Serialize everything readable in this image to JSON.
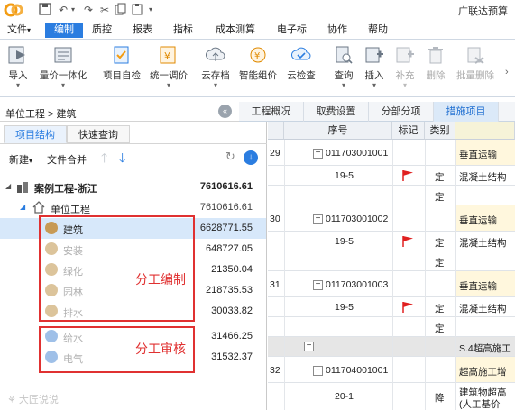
{
  "app": {
    "title": "广联达预算"
  },
  "menu": {
    "items": [
      "文件",
      "编制",
      "质控",
      "报表",
      "指标",
      "成本测算",
      "电子标",
      "协作",
      "帮助"
    ],
    "active": "编制"
  },
  "ribbon": {
    "buttons": [
      {
        "label": "导入",
        "icon": "import-icon",
        "dropdown": true,
        "disabled": false
      },
      {
        "label": "量价一体化",
        "icon": "volume-price-icon",
        "dropdown": true,
        "disabled": false
      },
      {
        "label": "项目自检",
        "icon": "self-check-icon",
        "dropdown": false,
        "disabled": false
      },
      {
        "label": "统一调价",
        "icon": "adjust-price-icon",
        "dropdown": true,
        "disabled": false
      },
      {
        "label": "云存档",
        "icon": "cloud-archive-icon",
        "dropdown": true,
        "disabled": false
      },
      {
        "label": "智能组价",
        "icon": "smart-pricing-icon",
        "dropdown": false,
        "disabled": false
      },
      {
        "label": "云检查",
        "icon": "cloud-check-icon",
        "dropdown": false,
        "disabled": false
      },
      {
        "label": "查询",
        "icon": "query-icon",
        "dropdown": true,
        "disabled": false
      },
      {
        "label": "插入",
        "icon": "insert-icon",
        "dropdown": true,
        "disabled": false
      },
      {
        "label": "补充",
        "icon": "supplement-icon",
        "dropdown": true,
        "disabled": true
      },
      {
        "label": "删除",
        "icon": "delete-icon",
        "dropdown": false,
        "disabled": true
      },
      {
        "label": "批量删除",
        "icon": "batch-delete-icon",
        "dropdown": false,
        "disabled": true
      }
    ]
  },
  "breadcrumb": {
    "text": "单位工程 > 建筑"
  },
  "right_tabs": [
    "工程概况",
    "取费设置",
    "分部分项",
    "措施项目"
  ],
  "right_tab_active": "措施项目",
  "left_panel": {
    "tabs": [
      "项目结构",
      "快速查询"
    ],
    "active_tab": "项目结构",
    "toolbar": {
      "new_label": "新建",
      "merge_label": "文件合并"
    },
    "tree": [
      {
        "name": "案例工程-浙江",
        "value": "7610616.61",
        "level": 0,
        "bold": true,
        "muted": false
      },
      {
        "name": "单位工程",
        "value": "7610616.61",
        "level": 1,
        "bold": false,
        "muted": false
      },
      {
        "name": "建筑",
        "value": "6628771.55",
        "level": 2,
        "bold": false,
        "muted": false,
        "selected": true
      },
      {
        "name": "安装",
        "value": "648727.05",
        "level": 2,
        "bold": false,
        "muted": true
      },
      {
        "name": "绿化",
        "value": "21350.04",
        "level": 2,
        "bold": false,
        "muted": true
      },
      {
        "name": "园林",
        "value": "218735.53",
        "level": 2,
        "bold": false,
        "muted": true
      },
      {
        "name": "排水",
        "value": "30033.82",
        "level": 2,
        "bold": false,
        "muted": true
      },
      {
        "name": "给水",
        "value": "31466.25",
        "level": 2,
        "bold": false,
        "muted": true
      },
      {
        "name": "电气",
        "value": "31532.37",
        "level": 2,
        "bold": false,
        "muted": true
      }
    ],
    "annotations": {
      "edit_label": "分工编制",
      "review_label": "分工审核"
    },
    "watermark": "大匠说说"
  },
  "grid": {
    "headers": [
      "",
      "序号",
      "标记",
      "类别",
      ""
    ],
    "rows": [
      {
        "num": "29",
        "code": "011703001001",
        "desc": "垂直运输",
        "type": "",
        "flag": false,
        "kind": "item"
      },
      {
        "num": "",
        "code": "19-5",
        "desc": "混凝土结构",
        "type": "定",
        "flag": true,
        "kind": "sub"
      },
      {
        "num": "",
        "code": "",
        "desc": "",
        "type": "定",
        "flag": false,
        "kind": "sub"
      },
      {
        "num": "30",
        "code": "011703001002",
        "desc": "垂直运输",
        "type": "",
        "flag": false,
        "kind": "item"
      },
      {
        "num": "",
        "code": "19-5",
        "desc": "混凝土结构",
        "type": "定",
        "flag": true,
        "kind": "sub"
      },
      {
        "num": "",
        "code": "",
        "desc": "",
        "type": "定",
        "flag": false,
        "kind": "sub"
      },
      {
        "num": "31",
        "code": "011703001003",
        "desc": "垂直运输",
        "type": "",
        "flag": false,
        "kind": "item"
      },
      {
        "num": "",
        "code": "19-5",
        "desc": "混凝土结构",
        "type": "定",
        "flag": true,
        "kind": "sub"
      },
      {
        "num": "",
        "code": "",
        "desc": "",
        "type": "定",
        "flag": false,
        "kind": "sub"
      },
      {
        "num": "",
        "code": "",
        "desc": "S.4超高施工",
        "type": "",
        "flag": false,
        "kind": "section"
      },
      {
        "num": "32",
        "code": "011704001001",
        "desc": "超高施工增",
        "type": "",
        "flag": false,
        "kind": "item"
      },
      {
        "num": "",
        "code": "20-1",
        "desc": "建筑物超高",
        "desc2": "(人工基价",
        "type": "降",
        "flag": false,
        "kind": "sub"
      }
    ]
  },
  "colors": {
    "accent": "#2b7de0",
    "annotation_red": "#e03131",
    "flag_red": "#e02020",
    "selected_row": "#d7e8fa"
  }
}
